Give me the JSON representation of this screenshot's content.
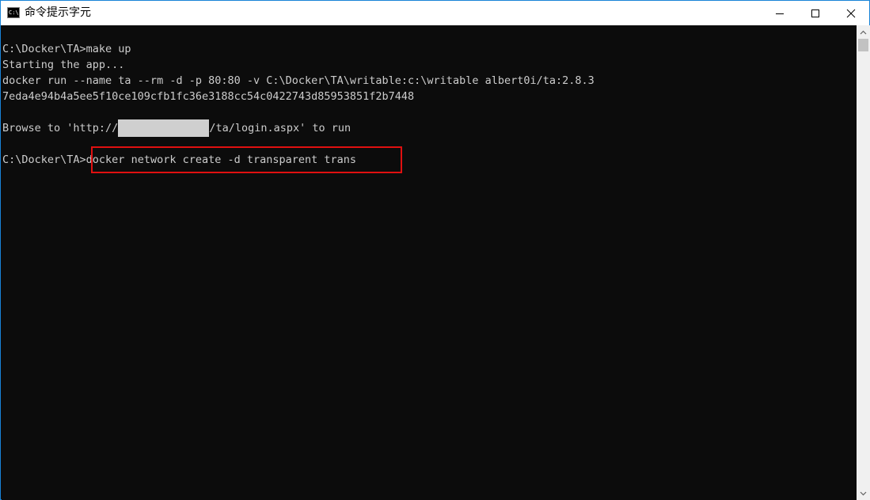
{
  "window": {
    "title": "命令提示字元",
    "icon_label": "C:\\",
    "accent_color": "#1883d7"
  },
  "icons": {
    "app": "command-prompt-icon",
    "minimize": "minimize-icon",
    "maximize": "maximize-icon",
    "close": "close-icon",
    "scroll_up": "chevron-up-icon",
    "scroll_down": "chevron-down-icon"
  },
  "console": {
    "background": "#0c0c0c",
    "text_color": "#cccccc",
    "lines": [
      "C:\\Docker\\TA>make up",
      "Starting the app...",
      "docker run --name ta --rm -d -p 80:80 -v C:\\Docker\\TA\\writable:c:\\writable albert0i/ta:2.8.3",
      "7eda4e94b4a5ee5f10ce109cfb1fc36e3188cc54c0422743d85953851f2b7448"
    ],
    "browse_line": {
      "prefix": "Browse to 'http://",
      "suffix": "/ta/login.aspx' to run"
    },
    "current": {
      "prompt": "C:\\Docker\\TA>",
      "command": "docker network create -d transparent trans"
    },
    "highlight_color": "#e01010"
  }
}
